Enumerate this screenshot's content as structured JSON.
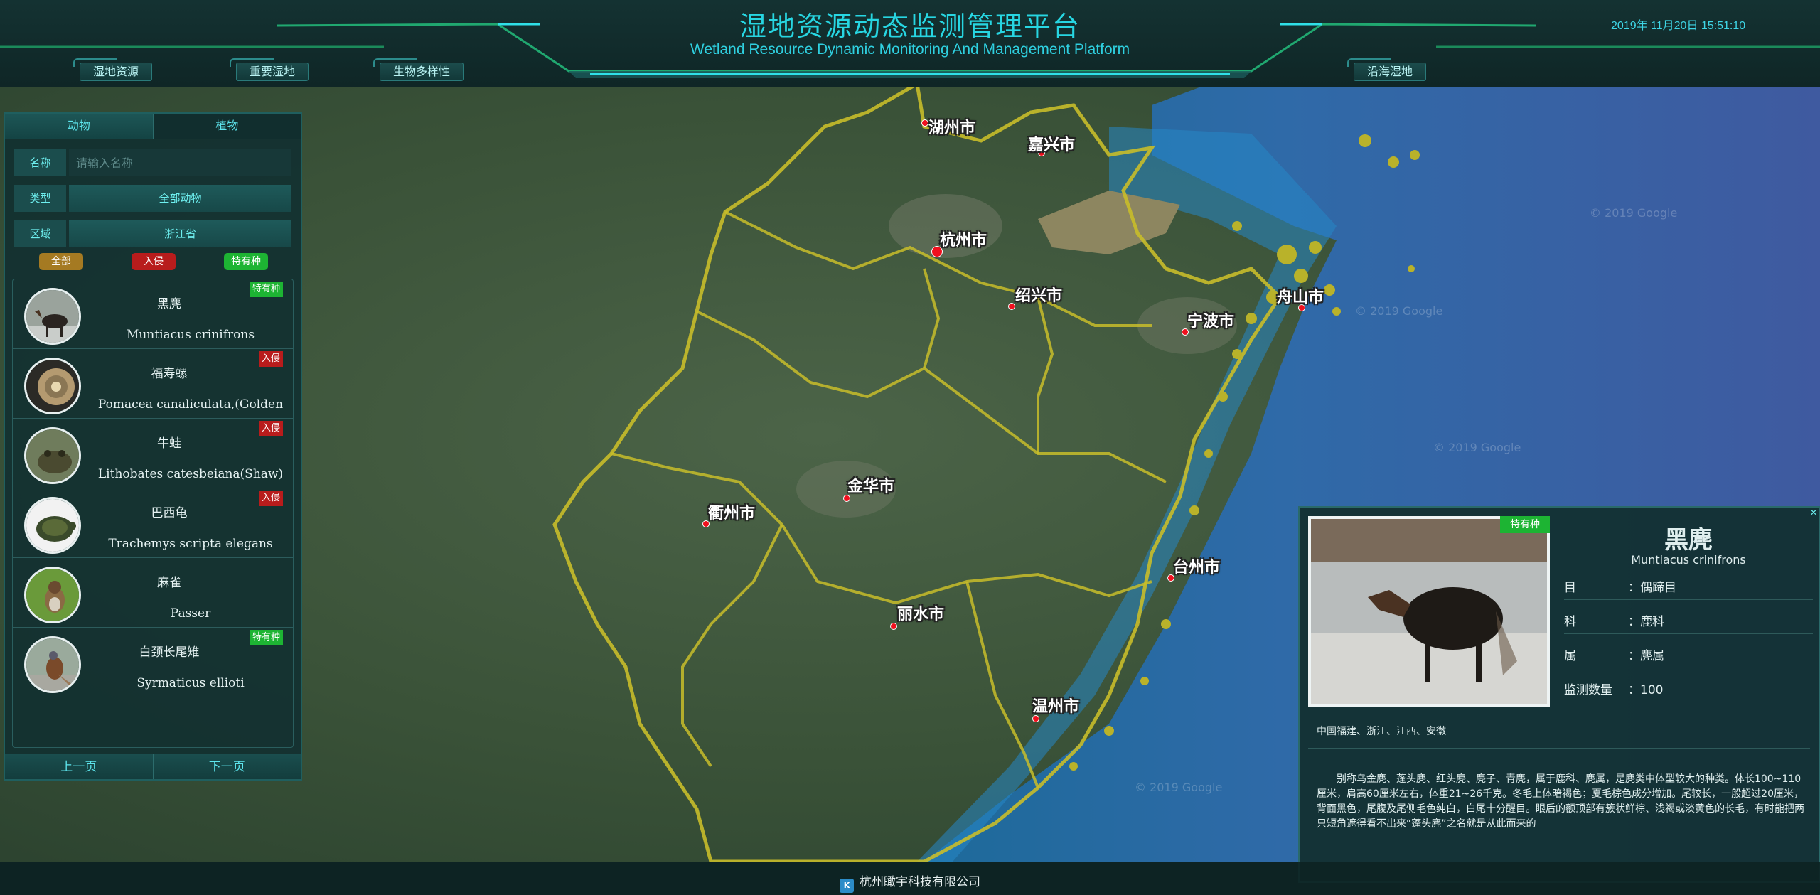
{
  "header": {
    "title": "湿地资源动态监测管理平台",
    "subtitle": "Wetland Resource Dynamic Monitoring And Management Platform",
    "datetime": "2019年 11月20日 15:51:10",
    "nav": [
      "湿地资源",
      "重要湿地",
      "生物多样性",
      "沿海湿地"
    ]
  },
  "left_panel": {
    "tabs": [
      "动物",
      "植物"
    ],
    "filters": {
      "name_label": "名称",
      "name_placeholder": "请输入名称",
      "type_label": "类型",
      "type_value": "全部动物",
      "region_label": "区域",
      "region_value": "浙江省"
    },
    "chips": [
      {
        "label": "全部",
        "color": "#a57a22"
      },
      {
        "label": "入侵",
        "color": "#b81c1c"
      },
      {
        "label": "特有种",
        "color": "#1db433"
      }
    ],
    "items": [
      {
        "cn": "黑麂",
        "latin": "Muntiacus crinifrons",
        "badge": "特有种",
        "kind": "endemic",
        "avatar": "deer"
      },
      {
        "cn": "福寿螺",
        "latin": "Pomacea canaliculata,(Golden",
        "badge": "入侵",
        "kind": "invasive",
        "avatar": "snail"
      },
      {
        "cn": "牛蛙",
        "latin": "Lithobates catesbeiana(Shaw)",
        "badge": "入侵",
        "kind": "invasive",
        "avatar": "frog"
      },
      {
        "cn": "巴西龟",
        "latin": "Trachemys scripta elegans",
        "badge": "入侵",
        "kind": "invasive",
        "avatar": "turtle"
      },
      {
        "cn": "麻雀",
        "latin": "Passer",
        "badge": "",
        "kind": "",
        "avatar": "sparrow"
      },
      {
        "cn": "白颈长尾雉",
        "latin": "Syrmaticus ellioti",
        "badge": "特有种",
        "kind": "endemic",
        "avatar": "pheasant"
      }
    ],
    "pager": {
      "prev": "上一页",
      "next": "下一页"
    }
  },
  "map": {
    "cities": [
      {
        "name": "湖州市"
      },
      {
        "name": "嘉兴市"
      },
      {
        "name": "杭州市"
      },
      {
        "name": "绍兴市"
      },
      {
        "name": "宁波市"
      },
      {
        "name": "舟山市"
      },
      {
        "name": "金华市"
      },
      {
        "name": "衢州市"
      },
      {
        "name": "台州市"
      },
      {
        "name": "丽水市"
      },
      {
        "name": "温州市"
      }
    ],
    "watermark": "© 2019 Google"
  },
  "detail": {
    "badge": "特有种",
    "name": "黑麂",
    "latin": "Muntiacus crinifrons",
    "order_label": "目",
    "order_value": "：偶蹄目",
    "family_label": "科",
    "family_value": "：鹿科",
    "genus_label": "属",
    "genus_value": "：麂属",
    "count_label": "监测数量",
    "count_value": "：100",
    "distribution": "中国福建、浙江、江西、安徽",
    "description": "别称乌金麂、蓬头麂、红头麂、麂子、青麂，属于鹿科、麂属，是麂类中体型较大的种类。体长100~110厘米，肩高60厘米左右，体重21~26千克。冬毛上体暗褐色；夏毛棕色成分增加。尾较长，一般超过20厘米，背面黑色，尾腹及尾侧毛色纯白，白尾十分醒目。眼后的额顶部有簇状鲜棕、浅褐或淡黄色的长毛，有时能把两只短角遮得看不出来“蓬头麂”之名就是从此而来的"
  },
  "footer": {
    "company": "杭州瞰宇科技有限公司",
    "logo": "K"
  }
}
